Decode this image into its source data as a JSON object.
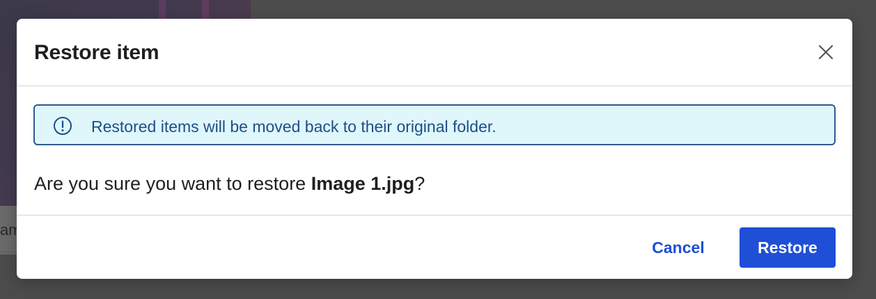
{
  "background": {
    "caption_fragment": "am"
  },
  "dialog": {
    "title": "Restore item",
    "close_icon": "close-icon",
    "alert": {
      "icon": "info-circle-icon",
      "text": "Restored items will be moved back to their original folder."
    },
    "question": {
      "prefix": "Are you sure you want to restore ",
      "item_name": "Image 1.jpg",
      "suffix": "?"
    },
    "buttons": {
      "cancel_label": "Cancel",
      "restore_label": "Restore"
    }
  },
  "colors": {
    "primary": "#1f4fd6",
    "alert_background": "#dff6fb",
    "alert_border": "#2d5a8c",
    "alert_text": "#1c4f86",
    "overlay": "#4c4c4c"
  }
}
